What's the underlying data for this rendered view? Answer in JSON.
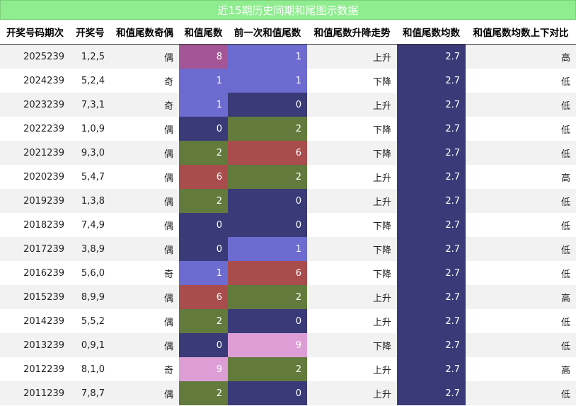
{
  "title": "近15期历史同期和尾图示数据",
  "colors": {
    "title_bg": "#8fec8f",
    "avg_bg": "#3a3a78",
    "tail_colors": {
      "0": "#3a3a78",
      "1": "#6b6bd0",
      "2": "#627a3c",
      "6": "#a84c4c",
      "8": "#a35595",
      "9": "#dd9ed6"
    }
  },
  "headers": [
    "开奖号码期次",
    "开奖号",
    "和值尾数奇偶",
    "和值尾数",
    "前一次和值尾数",
    "和值尾数升降走势",
    "和值尾数均数",
    "和值尾数均数上下对比"
  ],
  "rows": [
    {
      "period": "2025239",
      "numbers": "1,2,5",
      "parity": "偶",
      "tail": "8",
      "prev_tail": "1",
      "trend": "上升",
      "avg": "2.7",
      "compare": "高"
    },
    {
      "period": "2024239",
      "numbers": "5,2,4",
      "parity": "奇",
      "tail": "1",
      "prev_tail": "1",
      "trend": "下降",
      "avg": "2.7",
      "compare": "低"
    },
    {
      "period": "2023239",
      "numbers": "7,3,1",
      "parity": "奇",
      "tail": "1",
      "prev_tail": "0",
      "trend": "上升",
      "avg": "2.7",
      "compare": "低"
    },
    {
      "period": "2022239",
      "numbers": "1,0,9",
      "parity": "偶",
      "tail": "0",
      "prev_tail": "2",
      "trend": "下降",
      "avg": "2.7",
      "compare": "低"
    },
    {
      "period": "2021239",
      "numbers": "9,3,0",
      "parity": "偶",
      "tail": "2",
      "prev_tail": "6",
      "trend": "下降",
      "avg": "2.7",
      "compare": "低"
    },
    {
      "period": "2020239",
      "numbers": "5,4,7",
      "parity": "偶",
      "tail": "6",
      "prev_tail": "2",
      "trend": "上升",
      "avg": "2.7",
      "compare": "高"
    },
    {
      "period": "2019239",
      "numbers": "1,3,8",
      "parity": "偶",
      "tail": "2",
      "prev_tail": "0",
      "trend": "上升",
      "avg": "2.7",
      "compare": "低"
    },
    {
      "period": "2018239",
      "numbers": "7,4,9",
      "parity": "偶",
      "tail": "0",
      "prev_tail": "0",
      "trend": "下降",
      "avg": "2.7",
      "compare": "低"
    },
    {
      "period": "2017239",
      "numbers": "3,8,9",
      "parity": "偶",
      "tail": "0",
      "prev_tail": "1",
      "trend": "下降",
      "avg": "2.7",
      "compare": "低"
    },
    {
      "period": "2016239",
      "numbers": "5,6,0",
      "parity": "奇",
      "tail": "1",
      "prev_tail": "6",
      "trend": "下降",
      "avg": "2.7",
      "compare": "低"
    },
    {
      "period": "2015239",
      "numbers": "8,9,9",
      "parity": "偶",
      "tail": "6",
      "prev_tail": "2",
      "trend": "上升",
      "avg": "2.7",
      "compare": "高"
    },
    {
      "period": "2014239",
      "numbers": "5,5,2",
      "parity": "偶",
      "tail": "2",
      "prev_tail": "0",
      "trend": "上升",
      "avg": "2.7",
      "compare": "低"
    },
    {
      "period": "2013239",
      "numbers": "0,9,1",
      "parity": "偶",
      "tail": "0",
      "prev_tail": "9",
      "trend": "下降",
      "avg": "2.7",
      "compare": "低"
    },
    {
      "period": "2012239",
      "numbers": "8,1,0",
      "parity": "奇",
      "tail": "9",
      "prev_tail": "2",
      "trend": "上升",
      "avg": "2.7",
      "compare": "高"
    },
    {
      "period": "2011239",
      "numbers": "7,8,7",
      "parity": "偶",
      "tail": "2",
      "prev_tail": "0",
      "trend": "上升",
      "avg": "2.7",
      "compare": "低"
    }
  ]
}
